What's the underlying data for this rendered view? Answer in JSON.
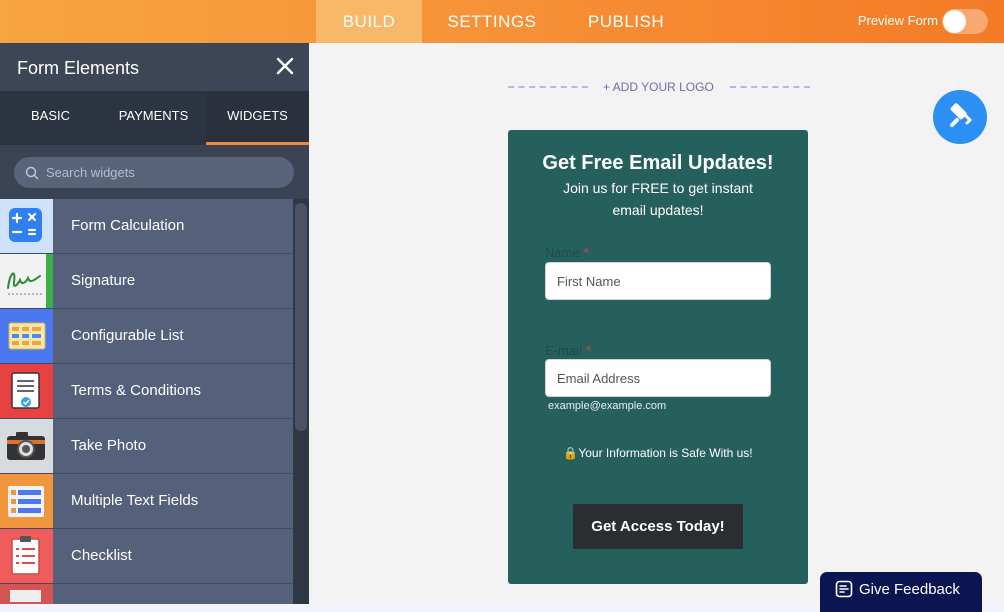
{
  "topbar": {
    "tabs": [
      {
        "label": "BUILD",
        "active": true
      },
      {
        "label": "SETTINGS",
        "active": false
      },
      {
        "label": "PUBLISH",
        "active": false
      }
    ],
    "preview_label": "Preview Form",
    "preview_on": false
  },
  "sidebar": {
    "title": "Form Elements",
    "tabs": [
      {
        "label": "BASIC",
        "active": false
      },
      {
        "label": "PAYMENTS",
        "active": false
      },
      {
        "label": "WIDGETS",
        "active": true
      }
    ],
    "search_placeholder": "Search widgets",
    "widgets": [
      {
        "label": "Form Calculation",
        "icon": "calculator-icon",
        "color": "#cfe2f9"
      },
      {
        "label": "Signature",
        "icon": "signature-icon",
        "color": "#3bae4a"
      },
      {
        "label": "Configurable List",
        "icon": "list-grid-icon",
        "color": "#4b78f0"
      },
      {
        "label": "Terms & Conditions",
        "icon": "document-check-icon",
        "color": "#e74242"
      },
      {
        "label": "Take Photo",
        "icon": "camera-icon",
        "color": "#c9ccd2"
      },
      {
        "label": "Multiple Text Fields",
        "icon": "text-fields-icon",
        "color": "#f0963c"
      },
      {
        "label": "Checklist",
        "icon": "clipboard-checklist-icon",
        "color": "#f05c5c"
      },
      {
        "label": "",
        "icon": "partial-widget-icon",
        "color": "#d25454"
      }
    ]
  },
  "canvas": {
    "add_logo_label": "+ ADD YOUR LOGO",
    "form": {
      "title": "Get Free Email Updates!",
      "subtitle": "Join us for FREE to get instant email updates!",
      "name_label": "Name",
      "name_placeholder": "First Name",
      "email_label": "E-mail",
      "email_placeholder": "Email Address",
      "email_hint": "example@example.com",
      "safe_text": "Your Information is Safe With us!",
      "submit_label": "Get Access Today!",
      "bg_color": "#26605c"
    },
    "feedback_label": "Give Feedback"
  }
}
